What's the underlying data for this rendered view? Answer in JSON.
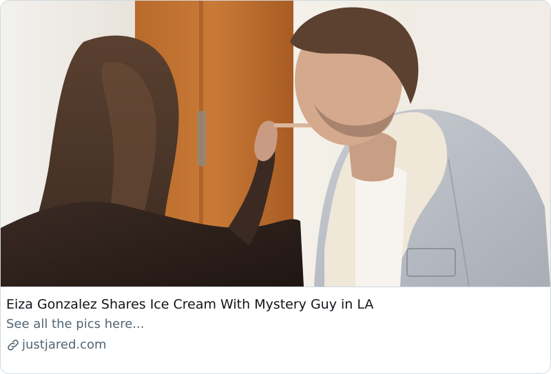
{
  "card": {
    "title": "Eiza Gonzalez Shares Ice Cream With Mystery Guy in LA",
    "description": "See all the pics here...",
    "domain": "justjared.com",
    "link_icon": "link-icon"
  },
  "media": {
    "image_subject": "photo"
  },
  "colors": {
    "border": "#cfd9de",
    "title": "#0f1419",
    "secondary": "#536471"
  }
}
